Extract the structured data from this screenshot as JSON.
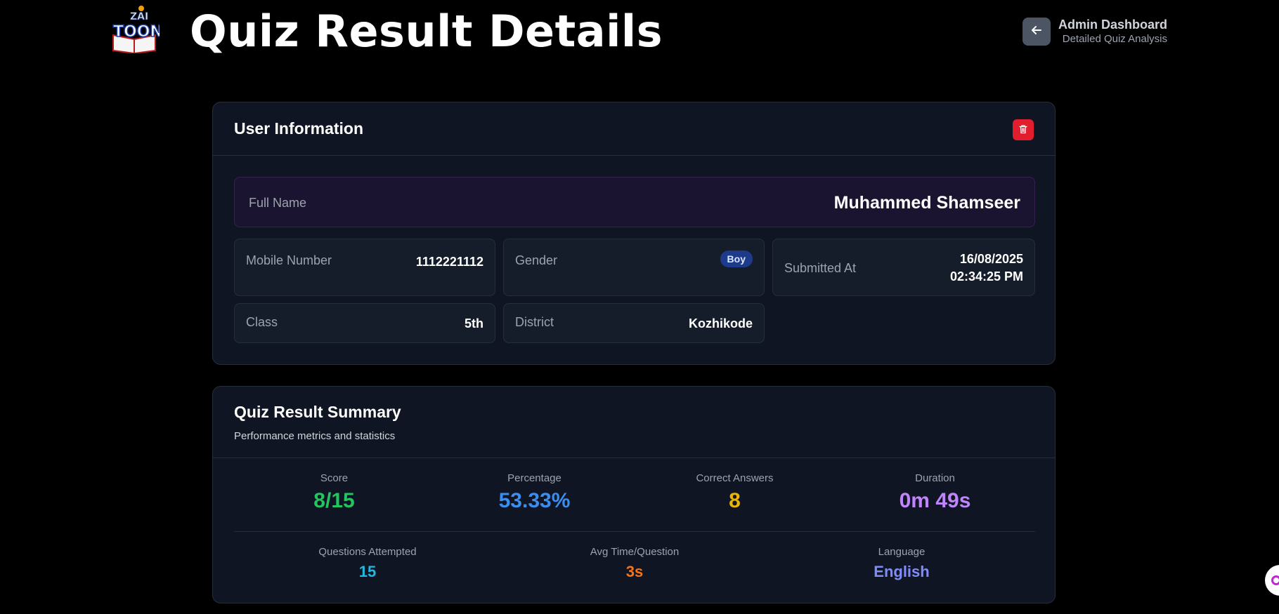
{
  "header": {
    "logo_text": "ZAI TOON",
    "title": "Quiz Result Details",
    "admin_title": "Admin Dashboard",
    "admin_subtitle": "Detailed Quiz Analysis",
    "back_icon": "arrow-left-icon"
  },
  "user_info": {
    "title": "User Information",
    "delete_icon": "trash-icon",
    "full_name_label": "Full Name",
    "full_name": "Muhammed Shamseer",
    "mobile_label": "Mobile Number",
    "mobile": "1112221112",
    "gender_label": "Gender",
    "gender": "Boy",
    "submitted_label": "Submitted At",
    "submitted_date": "16/08/2025",
    "submitted_time": "02:34:25 PM",
    "class_label": "Class",
    "class": "5th",
    "district_label": "District",
    "district": "Kozhikode"
  },
  "quiz_summary": {
    "title": "Quiz Result Summary",
    "subtitle": "Performance metrics and statistics",
    "stats_row1": [
      {
        "label": "Score",
        "value": "8/15",
        "color": "#22c55e"
      },
      {
        "label": "Percentage",
        "value": "53.33%",
        "color": "#3b8ef0"
      },
      {
        "label": "Correct Answers",
        "value": "8",
        "color": "#eab308"
      },
      {
        "label": "Duration",
        "value": "0m 49s",
        "color": "#c084fc"
      }
    ],
    "stats_row2": [
      {
        "label": "Questions Attempted",
        "value": "15",
        "color": "#22b8e0"
      },
      {
        "label": "Avg Time/Question",
        "value": "3s",
        "color": "#f97316"
      },
      {
        "label": "Language",
        "value": "English",
        "color": "#818cf8"
      }
    ]
  },
  "colors": {
    "background": "#000000",
    "card": "#0f1522",
    "delete": "#e11d2e",
    "badge": "#1e3a8a"
  }
}
